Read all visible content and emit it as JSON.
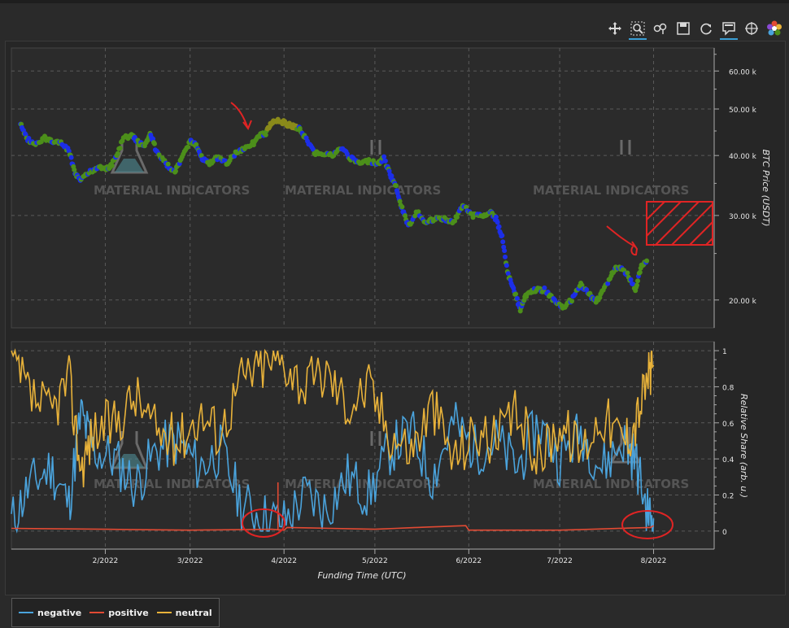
{
  "toolbar": {
    "tools": [
      {
        "icon": "pan-icon",
        "active": false
      },
      {
        "icon": "box-zoom-icon",
        "active": true
      },
      {
        "icon": "wheel-zoom-icon",
        "active": false
      },
      {
        "icon": "save-icon",
        "active": false
      },
      {
        "icon": "reset-icon",
        "active": false
      },
      {
        "icon": "hover-icon",
        "active": true
      },
      {
        "icon": "crosshair-icon",
        "active": false
      },
      {
        "icon": "bokeh-logo-icon",
        "active": false
      }
    ]
  },
  "colors": {
    "background": "#2a2a2a",
    "plot_bg": "#2b2b2b",
    "negative": "#4aa3dc",
    "positive": "#e24a33",
    "neutral": "#e8b23a",
    "price_neutral": "#4c8f1a",
    "price_negative": "#1c2ee8",
    "price_positive": "#8a8a1a",
    "annotation": "#e02424",
    "grid": "#5a5a5a",
    "watermark": "#555555"
  },
  "watermark": {
    "text": "MATERIAL INDICATORS"
  },
  "chart_data": [
    {
      "type": "scatter",
      "ylabel": "BTC Price (USDT)",
      "scale": "log",
      "ylim": [
        17500,
        67000
      ],
      "y_ticks": [
        20000,
        30000,
        40000,
        50000,
        60000
      ],
      "y_tick_labels": [
        "20.00 k",
        "30.00 k",
        "40.00 k",
        "50.00 k",
        "60.00 k"
      ],
      "grid": true,
      "series": [
        {
          "values": [
            [
              "2022-01-04",
              46500
            ],
            [
              "2022-01-06",
              43500
            ],
            [
              "2022-01-09",
              42000
            ],
            [
              "2022-01-12",
              43500
            ],
            [
              "2022-01-14",
              43000
            ],
            [
              "2022-01-17",
              42500
            ],
            [
              "2022-01-20",
              41000
            ],
            [
              "2022-01-22",
              36500
            ],
            [
              "2022-01-24",
              35500
            ],
            [
              "2022-01-27",
              37000
            ],
            [
              "2022-01-30",
              38000
            ],
            [
              "2022-02-02",
              37500
            ],
            [
              "2022-02-04",
              39000
            ],
            [
              "2022-02-07",
              43500
            ],
            [
              "2022-02-10",
              44000
            ],
            [
              "2022-02-12",
              42500
            ],
            [
              "2022-02-14",
              42000
            ],
            [
              "2022-02-16",
              44500
            ],
            [
              "2022-02-18",
              40500
            ],
            [
              "2022-02-21",
              38500
            ],
            [
              "2022-02-24",
              37000
            ],
            [
              "2022-02-26",
              39000
            ],
            [
              "2022-03-01",
              43000
            ],
            [
              "2022-03-03",
              42000
            ],
            [
              "2022-03-05",
              39500
            ],
            [
              "2022-03-07",
              38500
            ],
            [
              "2022-03-10",
              39500
            ],
            [
              "2022-03-13",
              38500
            ],
            [
              "2022-03-16",
              40500
            ],
            [
              "2022-03-19",
              41500
            ],
            [
              "2022-03-22",
              42500
            ],
            [
              "2022-03-24",
              44000
            ],
            [
              "2022-03-26",
              44500
            ],
            [
              "2022-03-28",
              47000
            ],
            [
              "2022-03-30",
              47500
            ],
            [
              "2022-04-02",
              46500
            ],
            [
              "2022-04-04",
              46000
            ],
            [
              "2022-04-06",
              45500
            ],
            [
              "2022-04-08",
              43500
            ],
            [
              "2022-04-11",
              40500
            ],
            [
              "2022-04-14",
              40500
            ],
            [
              "2022-04-17",
              40000
            ],
            [
              "2022-04-20",
              41500
            ],
            [
              "2022-04-23",
              39500
            ],
            [
              "2022-04-26",
              38500
            ],
            [
              "2022-04-29",
              39000
            ],
            [
              "2022-05-02",
              38500
            ],
            [
              "2022-05-04",
              39500
            ],
            [
              "2022-05-06",
              36500
            ],
            [
              "2022-05-08",
              34500
            ],
            [
              "2022-05-10",
              31000
            ],
            [
              "2022-05-12",
              28500
            ],
            [
              "2022-05-15",
              30500
            ],
            [
              "2022-05-18",
              29000
            ],
            [
              "2022-05-21",
              29500
            ],
            [
              "2022-05-24",
              29500
            ],
            [
              "2022-05-27",
              29000
            ],
            [
              "2022-05-30",
              31500
            ],
            [
              "2022-06-02",
              30000
            ],
            [
              "2022-06-05",
              30000
            ],
            [
              "2022-06-08",
              30500
            ],
            [
              "2022-06-10",
              29500
            ],
            [
              "2022-06-12",
              27000
            ],
            [
              "2022-06-14",
              22500
            ],
            [
              "2022-06-16",
              21000
            ],
            [
              "2022-06-18",
              19000
            ],
            [
              "2022-06-20",
              20500
            ],
            [
              "2022-06-23",
              21000
            ],
            [
              "2022-06-26",
              21000
            ],
            [
              "2022-06-29",
              20000
            ],
            [
              "2022-07-02",
              19300
            ],
            [
              "2022-07-05",
              20000
            ],
            [
              "2022-07-08",
              21500
            ],
            [
              "2022-07-11",
              20500
            ],
            [
              "2022-07-13",
              19800
            ],
            [
              "2022-07-15",
              20800
            ],
            [
              "2022-07-18",
              22500
            ],
            [
              "2022-07-20",
              23500
            ],
            [
              "2022-07-23",
              22800
            ],
            [
              "2022-07-26",
              21000
            ],
            [
              "2022-07-28",
              23500
            ],
            [
              "2022-07-30",
              24000
            ]
          ]
        }
      ]
    },
    {
      "type": "line",
      "xlabel": "Funding Time (UTC)",
      "ylabel": "Relative Share (arb. u.)",
      "ylim": [
        -0.1,
        1.05
      ],
      "y_ticks": [
        0,
        0.2,
        0.4,
        0.6,
        0.8,
        1
      ],
      "y_tick_labels": [
        "0",
        "0.2",
        "0.4",
        "0.6",
        "0.8",
        "1"
      ],
      "x_ticks": [
        "2/2022",
        "3/2022",
        "4/2022",
        "5/2022",
        "6/2022",
        "7/2022",
        "8/2022"
      ],
      "xlim": [
        "2022-01-01",
        "2022-08-21"
      ],
      "grid": true,
      "legend_position": "bottom-left",
      "series": [
        {
          "name": "negative",
          "values": [
            [
              "2022-01-01",
              0.05
            ],
            [
              "2022-01-07",
              0.25
            ],
            [
              "2022-01-14",
              0.35
            ],
            [
              "2022-01-20",
              0.15
            ],
            [
              "2022-01-24",
              0.65
            ],
            [
              "2022-01-28",
              0.45
            ],
            [
              "2022-02-04",
              0.4
            ],
            [
              "2022-02-11",
              0.25
            ],
            [
              "2022-02-18",
              0.45
            ],
            [
              "2022-02-25",
              0.5
            ],
            [
              "2022-03-04",
              0.35
            ],
            [
              "2022-03-11",
              0.45
            ],
            [
              "2022-03-18",
              0.15
            ],
            [
              "2022-03-25",
              0.08
            ],
            [
              "2022-04-01",
              0.05
            ],
            [
              "2022-04-08",
              0.2
            ],
            [
              "2022-04-15",
              0.12
            ],
            [
              "2022-04-22",
              0.3
            ],
            [
              "2022-04-29",
              0.2
            ],
            [
              "2022-05-06",
              0.45
            ],
            [
              "2022-05-13",
              0.55
            ],
            [
              "2022-05-20",
              0.3
            ],
            [
              "2022-05-27",
              0.6
            ],
            [
              "2022-06-03",
              0.45
            ],
            [
              "2022-06-10",
              0.5
            ],
            [
              "2022-06-17",
              0.35
            ],
            [
              "2022-06-24",
              0.6
            ],
            [
              "2022-07-01",
              0.4
            ],
            [
              "2022-07-08",
              0.55
            ],
            [
              "2022-07-15",
              0.35
            ],
            [
              "2022-07-22",
              0.5
            ],
            [
              "2022-07-26",
              0.4
            ],
            [
              "2022-07-30",
              0.1
            ],
            [
              "2022-08-01",
              0.07
            ]
          ]
        },
        {
          "name": "positive",
          "values": [
            [
              "2022-01-01",
              0.015
            ],
            [
              "2022-02-01",
              0.01
            ],
            [
              "2022-03-01",
              0.005
            ],
            [
              "2022-03-28",
              0.01
            ],
            [
              "2022-04-01",
              0.005
            ],
            [
              "2022-04-02",
              0.02
            ],
            [
              "2022-05-01",
              0.01
            ],
            [
              "2022-05-15",
              0.02
            ],
            [
              "2022-05-31",
              0.03
            ],
            [
              "2022-06-01",
              0.005
            ],
            [
              "2022-07-01",
              0.005
            ],
            [
              "2022-07-31",
              0.02
            ],
            [
              "2022-08-01",
              0.03
            ]
          ]
        },
        {
          "name": "neutral",
          "values": [
            [
              "2022-01-01",
              0.95
            ],
            [
              "2022-01-07",
              0.75
            ],
            [
              "2022-01-14",
              0.65
            ],
            [
              "2022-01-20",
              0.85
            ],
            [
              "2022-01-24",
              0.35
            ],
            [
              "2022-01-28",
              0.55
            ],
            [
              "2022-02-04",
              0.6
            ],
            [
              "2022-02-11",
              0.75
            ],
            [
              "2022-02-18",
              0.55
            ],
            [
              "2022-02-25",
              0.5
            ],
            [
              "2022-03-04",
              0.65
            ],
            [
              "2022-03-11",
              0.55
            ],
            [
              "2022-03-18",
              0.85
            ],
            [
              "2022-03-25",
              0.92
            ],
            [
              "2022-04-01",
              0.95
            ],
            [
              "2022-04-08",
              0.8
            ],
            [
              "2022-04-15",
              0.88
            ],
            [
              "2022-04-22",
              0.7
            ],
            [
              "2022-04-29",
              0.8
            ],
            [
              "2022-05-06",
              0.55
            ],
            [
              "2022-05-13",
              0.45
            ],
            [
              "2022-05-20",
              0.7
            ],
            [
              "2022-05-27",
              0.4
            ],
            [
              "2022-06-03",
              0.55
            ],
            [
              "2022-06-10",
              0.5
            ],
            [
              "2022-06-17",
              0.65
            ],
            [
              "2022-06-24",
              0.4
            ],
            [
              "2022-07-01",
              0.6
            ],
            [
              "2022-07-08",
              0.45
            ],
            [
              "2022-07-15",
              0.65
            ],
            [
              "2022-07-22",
              0.5
            ],
            [
              "2022-07-26",
              0.6
            ],
            [
              "2022-07-30",
              0.85
            ],
            [
              "2022-08-01",
              0.92
            ]
          ]
        }
      ]
    }
  ]
}
